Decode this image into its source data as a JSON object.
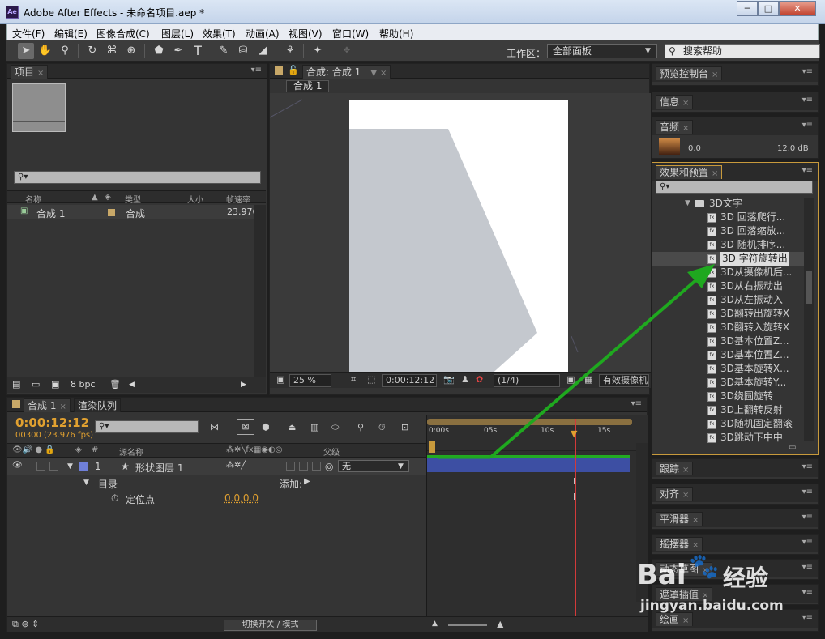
{
  "window": {
    "app_badge": "Ae",
    "title": "Adobe After Effects - 未命名项目.aep *",
    "controls": {
      "minimize": "─",
      "maximize": "□",
      "close": "✕"
    }
  },
  "menubar": [
    "文件(F)",
    "编辑(E)",
    "图像合成(C)",
    "图层(L)",
    "效果(T)",
    "动画(A)",
    "视图(V)",
    "窗口(W)",
    "帮助(H)"
  ],
  "toolbar": {
    "tools": [
      "selection-tool",
      "hand-tool",
      "zoom-tool",
      "rotate-tool",
      "camera-tool",
      "pan-behind-tool",
      "shape-tool",
      "pen-tool",
      "text-tool",
      "brush-tool",
      "clone-stamp-tool",
      "eraser-tool",
      "roto-brush-tool",
      "puppet-tool"
    ],
    "text_tool_glyph": "T",
    "workspace_label": "工作区：",
    "workspace_value": "全部面板",
    "help_search": "搜索帮助"
  },
  "project": {
    "tab": "项目",
    "columns": {
      "name": "名称",
      "type": "类型",
      "size": "大小",
      "rate": "帧速率"
    },
    "items": [
      {
        "name": "合成 1",
        "type": "合成",
        "rate": "23.976"
      }
    ],
    "bpc": "8 bpc"
  },
  "composition": {
    "tab": "合成: 合成 1",
    "sub_tab": "合成 1",
    "zoom": "25 %",
    "timecode": "0:00:12:12",
    "resolution": "(1/4)",
    "camera": "有效摄像机"
  },
  "right_panels": {
    "preview": "预览控制台",
    "info": "信息",
    "audio": "音频",
    "audio_level": "0.0",
    "audio_db": "12.0 dB",
    "effects": "效果和预置",
    "folder": "3D文字",
    "effects_items": [
      "3D 回落爬行...",
      "3D 回落缩放...",
      "3D 随机排序...",
      "3D 字符旋转出",
      "3D从摄像机后...",
      "3D从右振动出",
      "3D从左振动入",
      "3D翻转出旋转X",
      "3D翻转入旋转X",
      "3D基本位置Z...",
      "3D基本位置Z...",
      "3D基本旋转X...",
      "3D基本旋转Y...",
      "3D绕圆旋转",
      "3D上翻转反射",
      "3D随机固定翻滚",
      "3D跳动下中中"
    ],
    "selected_effect": "3D 字符旋转出",
    "tracking": "跟踪",
    "align": "对齐",
    "smoother": "平滑器",
    "wiggler": "摇摆器",
    "dynamic_sketch": "动态草图",
    "mask_interp": "遮罩插值",
    "paint": "绘画"
  },
  "timeline": {
    "tab": "合成 1",
    "render_tab": "渲染队列",
    "timecode": "0:00:12:12",
    "timecode_sub": "00300 (23.976 fps)",
    "col_num": "#",
    "col_source": "源名称",
    "col_parent": "父级",
    "layer": {
      "index": "1",
      "name": "形状图层 1",
      "parent": "无"
    },
    "contents": "目录",
    "add_label": "添加:",
    "anchor": "定位点",
    "anchor_value": "0.0,0.0",
    "ruler": [
      "0:00s",
      "05s",
      "10s",
      "15s"
    ],
    "switch_mode": "切换开关 / 模式"
  },
  "watermark": {
    "brand": "Bai",
    "brand2": "经验",
    "url": "jingyan.baidu.com"
  },
  "colors": {
    "accent_orange": "#e0a030",
    "layer_bar": "#3d4fa3",
    "arrow": "#1fa81f",
    "playhead": "#d23a3a"
  }
}
